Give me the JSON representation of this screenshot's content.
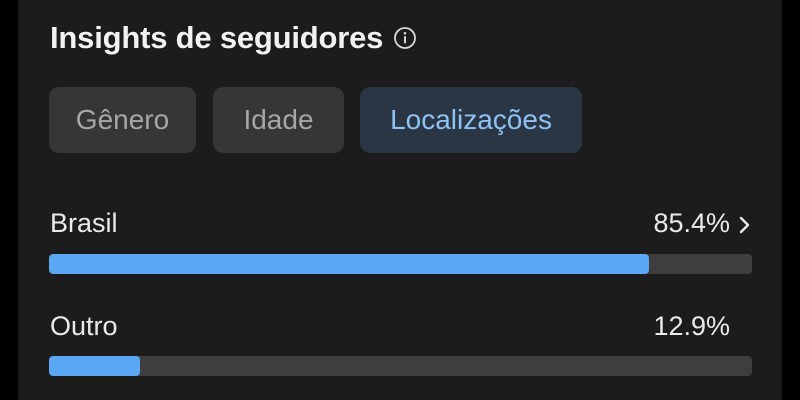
{
  "header": {
    "title": "Insights de seguidores",
    "info_icon": "info-circle-icon"
  },
  "tabs": [
    {
      "label": "Gênero",
      "selected": false
    },
    {
      "label": "Idade",
      "selected": false
    },
    {
      "label": "Localizações",
      "selected": true
    }
  ],
  "locations": [
    {
      "name": "Brasil",
      "value": "85.4%",
      "fraction": 0.854,
      "has_chevron": true
    },
    {
      "name": "Outro",
      "value": "12.9%",
      "fraction": 0.129,
      "has_chevron": false
    }
  ],
  "colors": {
    "panel_background": "#1c1c1c",
    "tab_background": "#363636",
    "tab_selected_background": "#2a3644",
    "tab_selected_text": "#8ec2f5",
    "bar_fill": "#5aa8f5",
    "bar_track": "#3e3e3e"
  },
  "icons": {
    "row_chevron": "chevron-right-icon"
  }
}
